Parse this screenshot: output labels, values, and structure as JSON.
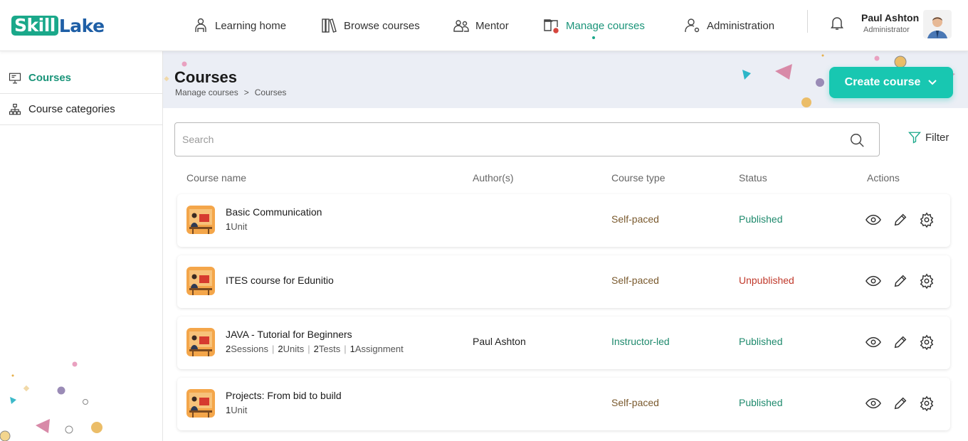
{
  "app": {
    "logo_part1": "Skill",
    "logo_part2": "Lake"
  },
  "nav": {
    "items": [
      {
        "label": "Learning home",
        "icon": "learner-icon"
      },
      {
        "label": "Browse courses",
        "icon": "books-icon"
      },
      {
        "label": "Mentor",
        "icon": "mentor-icon"
      },
      {
        "label": "Manage courses",
        "icon": "manage-courses-icon",
        "active": true
      },
      {
        "label": "Administration",
        "icon": "admin-user-icon"
      }
    ]
  },
  "user": {
    "name": "Paul Ashton",
    "role": "Administrator"
  },
  "sidebar": {
    "items": [
      {
        "label": "Courses",
        "icon": "monitor-icon",
        "active": true
      },
      {
        "label": "Course categories",
        "icon": "hierarchy-icon"
      }
    ]
  },
  "page": {
    "title": "Courses",
    "breadcrumb": [
      "Manage courses",
      ">",
      "Courses"
    ],
    "create_label": "Create course"
  },
  "search": {
    "placeholder": "Search",
    "value": ""
  },
  "filter_label": "Filter",
  "table": {
    "headers": [
      "Course name",
      "Author(s)",
      "Course type",
      "Status",
      "Actions"
    ],
    "rows": [
      {
        "name": "Basic Communication",
        "meta": [
          {
            "n": "1",
            "t": "Unit"
          }
        ],
        "author": "",
        "type": "Self-paced",
        "status": "Published"
      },
      {
        "name": "ITES course for Edunitio",
        "meta": [],
        "author": "",
        "type": "Self-paced",
        "status": "Unpublished"
      },
      {
        "name": "JAVA - Tutorial for Beginners",
        "meta": [
          {
            "n": "2",
            "t": "Sessions"
          },
          {
            "n": "2",
            "t": "Units"
          },
          {
            "n": "2",
            "t": "Tests"
          },
          {
            "n": "1",
            "t": "Assignment"
          }
        ],
        "author": "Paul Ashton",
        "type": "Instructor-led",
        "status": "Published"
      },
      {
        "name": "Projects: From bid to build",
        "meta": [
          {
            "n": "1",
            "t": "Unit"
          }
        ],
        "author": "",
        "type": "Self-paced",
        "status": "Published"
      }
    ]
  },
  "colors": {
    "brand": "#1aa88a",
    "accent": "#18c7b1",
    "published": "#1f8a6d",
    "unpublished": "#c0392b",
    "self_paced": "#7a5a2e",
    "instructor_led": "#1f8a6d"
  }
}
